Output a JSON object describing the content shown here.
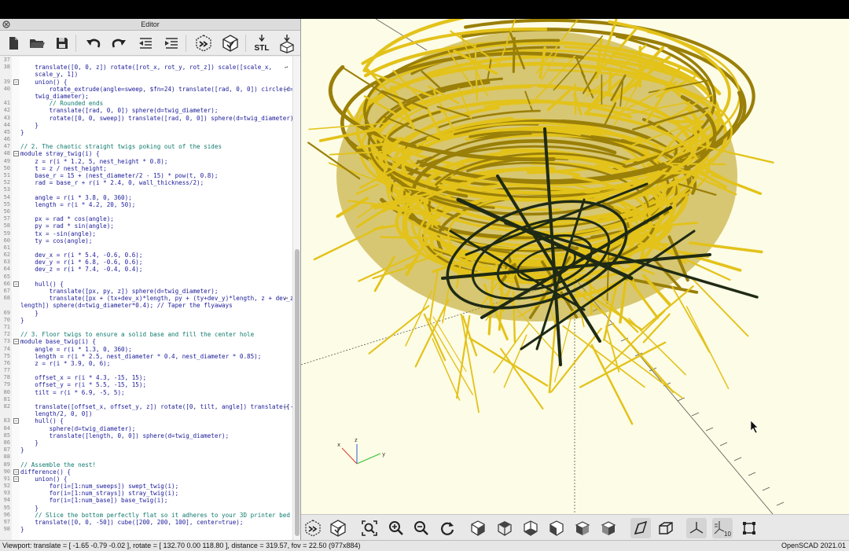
{
  "editor": {
    "title": "Editor",
    "toolbar": [
      "new-file",
      "open-file",
      "save-file",
      "undo",
      "redo",
      "unindent",
      "indent",
      "preview",
      "render",
      "export-stl",
      "send-to-printer"
    ],
    "stl_label": "STL"
  },
  "code_lines": [
    {
      "n": "37",
      "t": "",
      "c": "kw"
    },
    {
      "n": "38",
      "t": "    translate([0, 0, z]) rotate([rot_x, rot_y, rot_z]) scale([scale_x,",
      "c": "kw",
      "wrap": true
    },
    {
      "n": "",
      "t": "    scale_y, 1])",
      "c": "kw"
    },
    {
      "n": "39",
      "t": "    union() {",
      "c": "kw",
      "fold": true
    },
    {
      "n": "40",
      "t": "        rotate_extrude(angle=sweep, $fn=24) translate([rad, 0, 0]) circle(d=",
      "c": "kw",
      "wrap": true
    },
    {
      "n": "",
      "t": "    twig_diameter);",
      "c": "kw"
    },
    {
      "n": "41",
      "t": "        // Rounded ends",
      "c": "cm"
    },
    {
      "n": "42",
      "t": "        translate([rad, 0, 0]) sphere(d=twig_diameter);",
      "c": "kw"
    },
    {
      "n": "43",
      "t": "        rotate([0, 0, sweep]) translate([rad, 0, 0]) sphere(d=twig_diameter);",
      "c": "kw"
    },
    {
      "n": "44",
      "t": "    }",
      "c": "kw"
    },
    {
      "n": "45",
      "t": "}",
      "c": "kw"
    },
    {
      "n": "46",
      "t": "",
      "c": "kw"
    },
    {
      "n": "47",
      "t": "// 2. The chaotic straight twigs poking out of the sides",
      "c": "cm"
    },
    {
      "n": "48",
      "t": "module stray_twig(i) {",
      "c": "kw",
      "fold": true
    },
    {
      "n": "49",
      "t": "    z = r(i * 1.2, 5, nest_height * 0.8);",
      "c": "kw"
    },
    {
      "n": "50",
      "t": "    t = z / nest_height;",
      "c": "kw"
    },
    {
      "n": "51",
      "t": "    base_r = 15 + (nest_diameter/2 - 15) * pow(t, 0.8);",
      "c": "kw"
    },
    {
      "n": "52",
      "t": "    rad = base_r + r(i * 2.4, 0, wall_thickness/2);",
      "c": "kw"
    },
    {
      "n": "53",
      "t": "",
      "c": "kw"
    },
    {
      "n": "54",
      "t": "    angle = r(i * 3.8, 0, 360);",
      "c": "kw"
    },
    {
      "n": "55",
      "t": "    length = r(i * 4.2, 20, 50);",
      "c": "kw"
    },
    {
      "n": "56",
      "t": "",
      "c": "kw"
    },
    {
      "n": "57",
      "t": "    px = rad * cos(angle);",
      "c": "kw"
    },
    {
      "n": "58",
      "t": "    py = rad * sin(angle);",
      "c": "kw"
    },
    {
      "n": "59",
      "t": "    tx = -sin(angle);",
      "c": "kw"
    },
    {
      "n": "60",
      "t": "    ty = cos(angle);",
      "c": "kw"
    },
    {
      "n": "61",
      "t": "",
      "c": "kw"
    },
    {
      "n": "62",
      "t": "    dev_x = r(i * 5.4, -0.6, 0.6);",
      "c": "kw"
    },
    {
      "n": "63",
      "t": "    dev_y = r(i * 6.8, -0.6, 0.6);",
      "c": "kw"
    },
    {
      "n": "64",
      "t": "    dev_z = r(i * 7.4, -0.4, 0.4);",
      "c": "kw"
    },
    {
      "n": "65",
      "t": "",
      "c": "kw"
    },
    {
      "n": "66",
      "t": "    hull() {",
      "c": "kw",
      "fold": true
    },
    {
      "n": "67",
      "t": "        translate([px, py, z]) sphere(d=twig_diameter);",
      "c": "kw"
    },
    {
      "n": "68",
      "t": "        translate([px + (tx+dev_x)*length, py + (ty+dev_y)*length, z + dev_z*",
      "c": "kw",
      "wrap": true
    },
    {
      "n": "",
      "t": "length]) sphere(d=twig_diameter*0.4); // Taper the flyaways",
      "c": "kw"
    },
    {
      "n": "69",
      "t": "    }",
      "c": "kw"
    },
    {
      "n": "70",
      "t": "}",
      "c": "kw"
    },
    {
      "n": "71",
      "t": "",
      "c": "kw"
    },
    {
      "n": "72",
      "t": "// 3. Floor twigs to ensure a solid base and fill the center hole",
      "c": "cm"
    },
    {
      "n": "73",
      "t": "module base_twig(i) {",
      "c": "kw",
      "fold": true
    },
    {
      "n": "74",
      "t": "    angle = r(i * 1.3, 0, 360);",
      "c": "kw"
    },
    {
      "n": "75",
      "t": "    length = r(i * 2.5, nest_diameter * 0.4, nest_diameter * 0.85);",
      "c": "kw"
    },
    {
      "n": "76",
      "t": "    z = r(i * 3.9, 0, 6);",
      "c": "kw"
    },
    {
      "n": "77",
      "t": "",
      "c": "kw"
    },
    {
      "n": "78",
      "t": "    offset_x = r(i * 4.3, -15, 15);",
      "c": "kw"
    },
    {
      "n": "79",
      "t": "    offset_y = r(i * 5.5, -15, 15);",
      "c": "kw"
    },
    {
      "n": "80",
      "t": "    tilt = r(i * 6.9, -5, 5);",
      "c": "kw"
    },
    {
      "n": "81",
      "t": "",
      "c": "kw"
    },
    {
      "n": "82",
      "t": "    translate([offset_x, offset_y, z]) rotate([0, tilt, angle]) translate([-",
      "c": "kw",
      "wrap": true
    },
    {
      "n": "",
      "t": "    length/2, 0, 0])",
      "c": "kw"
    },
    {
      "n": "83",
      "t": "    hull() {",
      "c": "kw",
      "fold": true
    },
    {
      "n": "84",
      "t": "        sphere(d=twig_diameter);",
      "c": "kw"
    },
    {
      "n": "85",
      "t": "        translate([length, 0, 0]) sphere(d=twig_diameter);",
      "c": "kw"
    },
    {
      "n": "86",
      "t": "    }",
      "c": "kw"
    },
    {
      "n": "87",
      "t": "}",
      "c": "kw"
    },
    {
      "n": "88",
      "t": "",
      "c": "kw"
    },
    {
      "n": "89",
      "t": "// Assemble the nest!",
      "c": "cm"
    },
    {
      "n": "90",
      "t": "difference() {",
      "c": "kw",
      "fold": true
    },
    {
      "n": "91",
      "t": "    union() {",
      "c": "kw",
      "fold": true
    },
    {
      "n": "92",
      "t": "        for(i=[1:num_sweeps]) swept_twig(i);",
      "c": "kw"
    },
    {
      "n": "93",
      "t": "        for(i=[1:num_strays]) stray_twig(i);",
      "c": "kw"
    },
    {
      "n": "94",
      "t": "        for(i=[1:num_base]) base_twig(i);",
      "c": "kw"
    },
    {
      "n": "95",
      "t": "    }",
      "c": "kw"
    },
    {
      "n": "96",
      "t": "    // Slice the bottom perfectly flat so it adheres to your 3D printer bed",
      "c": "cm"
    },
    {
      "n": "97",
      "t": "    translate([0, 0, -50]) cube([200, 200, 100], center=true);",
      "c": "kw"
    },
    {
      "n": "98",
      "t": "}",
      "c": "kw"
    }
  ],
  "viewport": {
    "axis_labels": {
      "x": "x",
      "y": "y",
      "z": "z"
    },
    "toolbar": [
      "preview-render",
      "render-3d",
      "view-all",
      "zoom-in",
      "zoom-out",
      "reset-view",
      "view-right",
      "view-top",
      "view-bottom",
      "view-left",
      "view-front",
      "view-back",
      "perspective",
      "orthogonal",
      "show-axes",
      "show-scale-markers",
      "show-edges"
    ],
    "scale_label": "10"
  },
  "status": {
    "viewport": "Viewport: translate = [ -1.65 -0.79 -0.02 ], rotate = [ 132.70 0.00 118.80 ], distance = 319.57, fov = 22.50 (977x884)",
    "version": "OpenSCAD 2021.01"
  },
  "colors": {
    "twig": "#e3c21a",
    "twig_shade": "#9a7f08",
    "cut": "#1f2a14",
    "viewport_bg": "#fdfce6"
  }
}
